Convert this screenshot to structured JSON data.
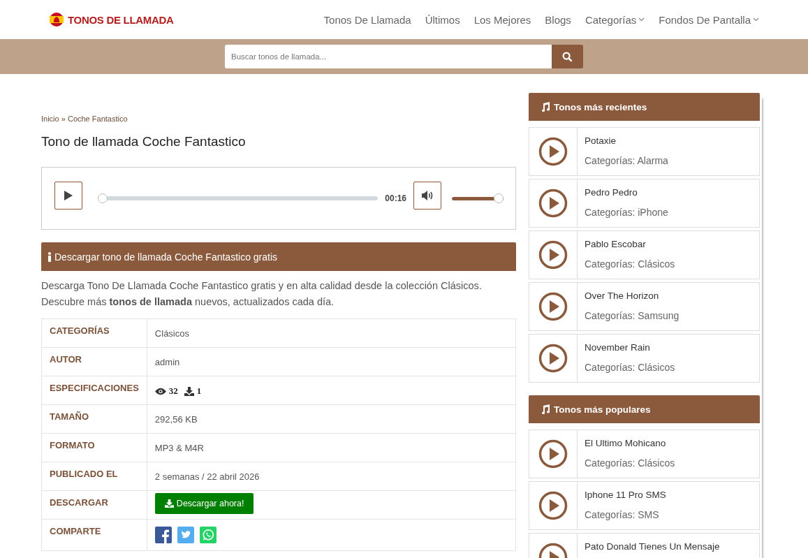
{
  "header": {
    "logo": "TONOS DE LLAMADA",
    "nav": [
      {
        "label": "Tonos De Llamada",
        "dropdown": false
      },
      {
        "label": "Últimos",
        "dropdown": false
      },
      {
        "label": "Los Mejores",
        "dropdown": false
      },
      {
        "label": "Blogs",
        "dropdown": false
      },
      {
        "label": "Categorías",
        "dropdown": true
      },
      {
        "label": "Fondos De Pantalla",
        "dropdown": true
      }
    ]
  },
  "search": {
    "placeholder": "Buscar tonos de llamada..."
  },
  "breadcrumb": {
    "home": "Inicio",
    "separator": "»",
    "current": "Coche Fantastico"
  },
  "title": "Tono de llamada Coche Fantastico",
  "player": {
    "time": "00:16",
    "progress": {
      "level": 0
    },
    "volume": {
      "level": 1
    }
  },
  "info": {
    "heading": "Descargar tono de llamada Coche Fantastico gratis",
    "text": "Descarga Tono De Llamada Coche Fantastico gratis y en alta calidad desde la colección Clásicos. Descubre más **tonos de llamada** nuevos, actualizados cada día."
  },
  "details": [
    {
      "kind": "text",
      "label": "CATEGORÍAS",
      "value": "Clásicos"
    },
    {
      "kind": "text",
      "label": "AUTOR",
      "value": "admin"
    },
    {
      "kind": "stats",
      "label": "ESPECIFICACIONES",
      "views": "32",
      "downloads": "1"
    },
    {
      "kind": "text",
      "label": "TAMAÑO",
      "value": "292,56 KB"
    },
    {
      "kind": "text",
      "label": "FORMATO",
      "value": "MP3 & M4R"
    },
    {
      "kind": "text",
      "label": "PUBLICADO EL",
      "value": "2 semanas / 22 abril 2026"
    },
    {
      "kind": "download",
      "label": "DESCARGAR",
      "button": "Descargar ahora!"
    },
    {
      "kind": "share",
      "label": "COMPARTE"
    }
  ],
  "sidebar": [
    {
      "title": "Tonos más recientes",
      "items": [
        {
          "name": "Potaxie",
          "category": "Categorías: Alarma"
        },
        {
          "name": "Pedro Pedro",
          "category": "Categorías: iPhone"
        },
        {
          "name": "Pablo Escobar",
          "category": "Categorías: Clásicos"
        },
        {
          "name": "Over The Horizon",
          "category": "Categorías: Samsung"
        },
        {
          "name": "November Rain",
          "category": "Categorías: Clásicos"
        }
      ]
    },
    {
      "title": "Tonos más populares",
      "items": [
        {
          "name": "El Ultimo Mohicano",
          "category": "Categorías: Clásicos"
        },
        {
          "name": "Iphone 11 Pro SMS",
          "category": "Categorías: SMS"
        },
        {
          "name": "Pato Donald Tienes Un Mensaje"
        }
      ]
    }
  ]
}
